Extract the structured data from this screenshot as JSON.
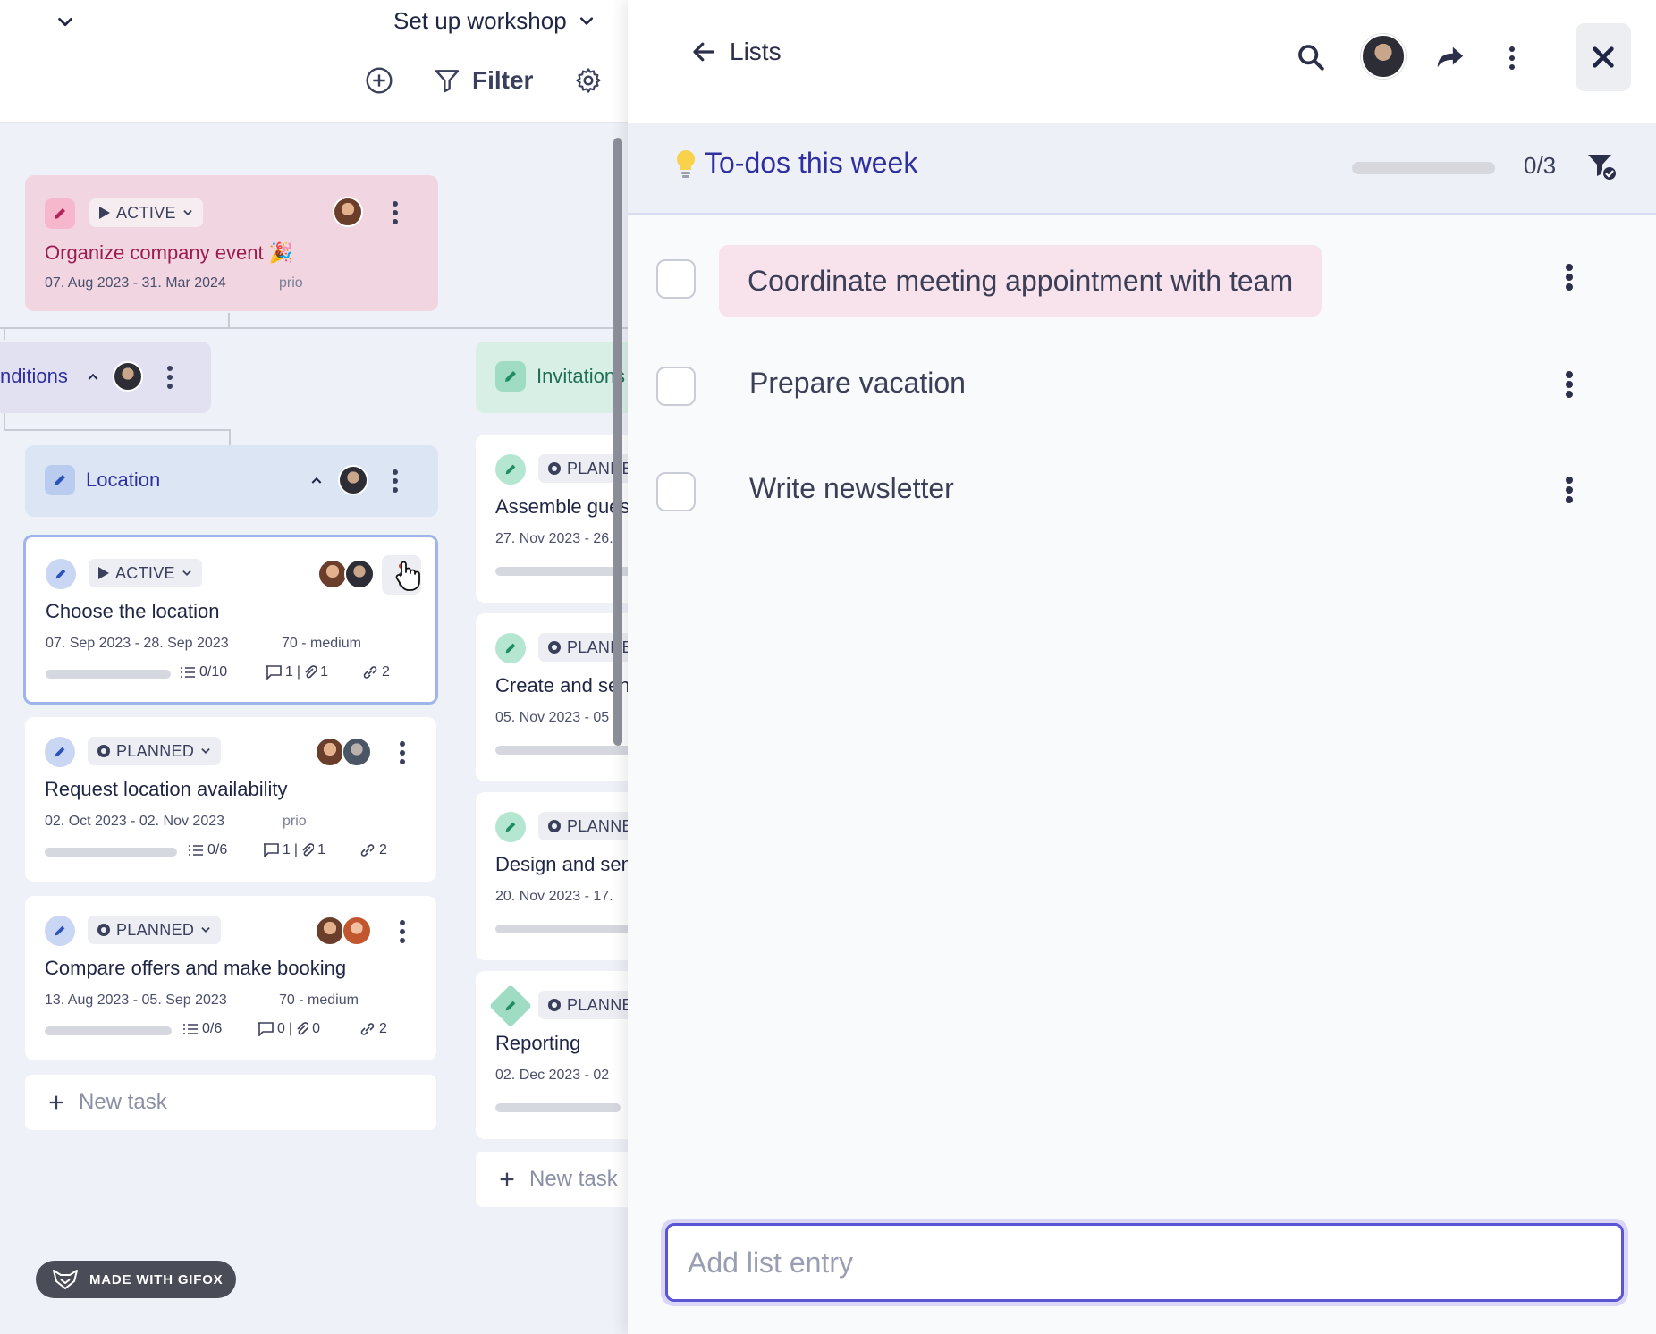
{
  "board": {
    "project_title": "Set up workshop",
    "toolbar": {
      "filter_label": "Filter"
    },
    "parent_card": {
      "status": "ACTIVE",
      "title": "Organize company event 🎉",
      "dates": "07. Aug 2023 - 31. Mar 2024",
      "priority": "prio"
    },
    "group_conditions": {
      "label": "nditions"
    },
    "group_location": {
      "label": "Location"
    },
    "group_invitations": {
      "label": "Invitations"
    },
    "tasks": [
      {
        "status": "ACTIVE",
        "title": "Choose the location",
        "dates": "07. Sep 2023 - 28. Sep 2023",
        "priority": "70 - medium",
        "checklist": "0/10",
        "comments": "1",
        "attachments": "1",
        "links": "2"
      },
      {
        "status": "PLANNED",
        "title": "Request location availability",
        "dates": "02. Oct 2023 - 02. Nov 2023",
        "priority": "prio",
        "checklist": "0/6",
        "comments": "1",
        "attachments": "1",
        "links": "2"
      },
      {
        "status": "PLANNED",
        "title": "Compare offers and make booking",
        "dates": "13. Aug 2023 - 05. Sep 2023",
        "priority": "70 - medium",
        "checklist": "0/6",
        "comments": "0",
        "attachments": "0",
        "links": "2"
      }
    ],
    "invitation_tasks": [
      {
        "status": "PLANNED",
        "title": "Assemble guest list",
        "dates": "27. Nov 2023 - 26."
      },
      {
        "status": "PLANNED",
        "title": "Create and send",
        "dates": "05. Nov 2023 - 05"
      },
      {
        "status": "PLANNED",
        "title": "Design and send",
        "dates": "20. Nov 2023 - 17."
      },
      {
        "status": "PLANNED",
        "title": "Reporting",
        "dates": "02. Dec 2023 - 02"
      }
    ],
    "new_task_label": "New task",
    "watermark": "MADE WITH GIFOX"
  },
  "panel": {
    "back_label": "Lists",
    "list_title": "To-dos this week",
    "list_count": "0/3",
    "list_progress": 0,
    "entries": [
      {
        "text": "Coordinate meeting appointment with team",
        "checked": false,
        "highlighted": true
      },
      {
        "text": "Prepare vacation",
        "checked": false,
        "highlighted": false
      },
      {
        "text": "Write newsletter",
        "checked": false,
        "highlighted": false
      }
    ],
    "add_placeholder": "Add list entry"
  },
  "colors": {
    "accent": "#2f2fa0",
    "active_card": "#f1d6e2",
    "location_group": "#dbe5f4",
    "invitations_group": "#d8efe6",
    "highlight_entry": "#f8e3ec"
  }
}
